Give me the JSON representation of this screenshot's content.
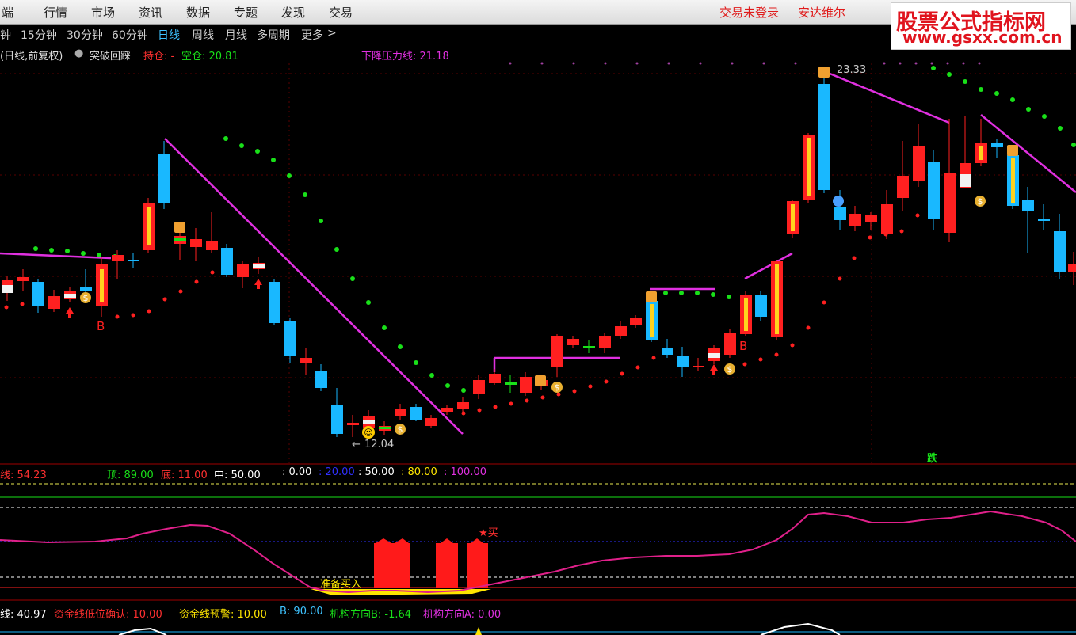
{
  "menu": {
    "items": [
      "端",
      "行情",
      "市场",
      "资讯",
      "数据",
      "专题",
      "发现",
      "交易"
    ],
    "login_status": "交易未登录",
    "broker": "安达维尔"
  },
  "watermark": {
    "line1": "股票公式指标网",
    "line2": "www.gsxx.com.cn"
  },
  "periods": {
    "items": [
      "钟",
      "15分钟",
      "30分钟",
      "60分钟",
      "日线",
      "周线",
      "月线",
      "多周期",
      "更多"
    ],
    "active": "日线",
    "more_chevron": ">"
  },
  "main_chart": {
    "title": "(日线,前复权)",
    "indicator_name": "突破回踩",
    "hold_label": "持仓: -",
    "empty_label": "空仓: 20.81",
    "pressure_label": "下降压力线: 21.18",
    "high_label": "23.33",
    "low_label": "12.04",
    "sell_badge": "跌",
    "buy_marker": "B"
  },
  "sub1": {
    "name_value": "线: 54.23",
    "top": "顶: 89.00",
    "bottom": "底: 11.00",
    "mid": "中: 50.00",
    "v0": ": 0.00",
    "v20": ": 20.00",
    "v50": ": 50.00",
    "v80": ": 80.00",
    "v100": ": 100.00",
    "ready_buy": "准备买入",
    "buy_signal": "★买"
  },
  "sub2": {
    "line": "线: 40.97",
    "confirm": "资金线低位确认: 10.00",
    "warn": "资金线预警: 10.00",
    "b": "B: 90.00",
    "dir_b": "机构方向B: -1.64",
    "dir_a": "机构方向A: 0.00"
  },
  "colors": {
    "up": "#ff1a1a",
    "down": "#19b8ff",
    "magenta": "#e030e0",
    "green": "#19e019"
  }
}
